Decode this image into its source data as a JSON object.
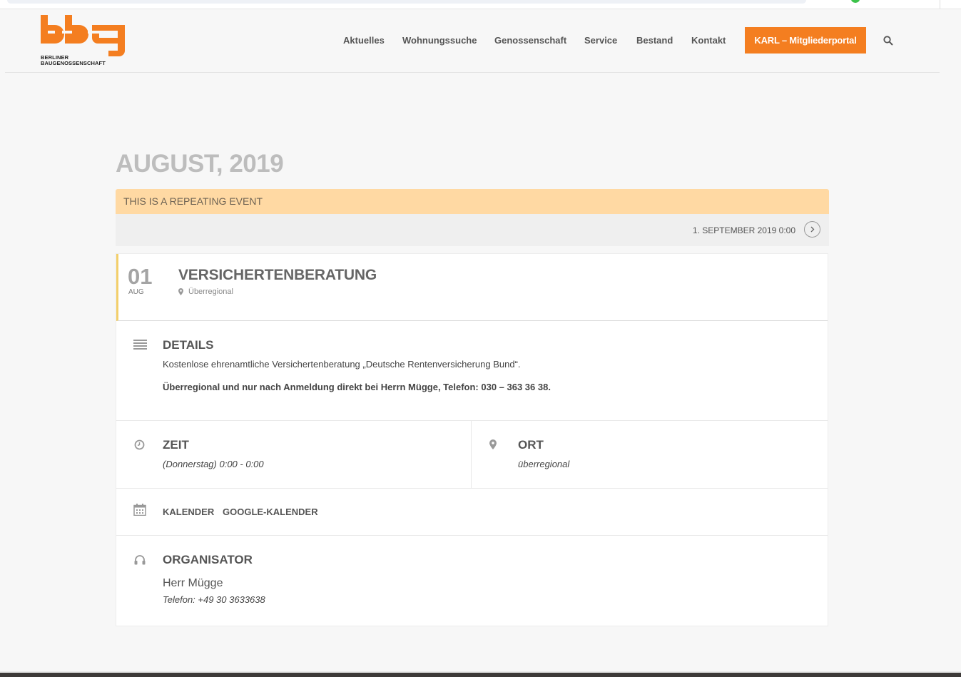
{
  "header": {
    "logo_lines": [
      "BERLINER",
      "BAUGENOSSENSCHAFT"
    ],
    "nav": [
      "Aktuelles",
      "Wohnungssuche",
      "Genossenschaft",
      "Service",
      "Bestand",
      "Kontakt"
    ],
    "cta_label": "KARL – Mitgliederportal"
  },
  "month_title": "AUGUST, 2019",
  "repeat_banner": "THIS IS A REPEATING EVENT",
  "next_event": "1. SEPTEMBER 2019 0:00",
  "event": {
    "day": "01",
    "month": "AUG",
    "title": "VERSICHERTENBERATUNG",
    "location": "Überregional"
  },
  "details": {
    "title": "DETAILS",
    "text1": "Kostenlose ehrenamtliche Versichertenberatung „Deutsche Rentenversicherung Bund“.",
    "text2": "Überregional und nur nach Anmeldung direkt bei Herrn Mügge, Telefon: 030 – 363 36 38."
  },
  "zeit": {
    "title": "ZEIT",
    "value": "(Donnerstag) 0:00 - 0:00"
  },
  "ort": {
    "title": "ORT",
    "value": "überregional"
  },
  "calendar_links": [
    "KALENDER",
    "GOOGLE-KALENDER"
  ],
  "organisator": {
    "title": "ORGANISATOR",
    "name": "Herr Mügge",
    "phone": "Telefon: +49 30 3633638"
  },
  "colors": {
    "brand_orange": "#f47e20",
    "banner": "#ffd9a3",
    "accent_line": "#f3cf6a"
  }
}
